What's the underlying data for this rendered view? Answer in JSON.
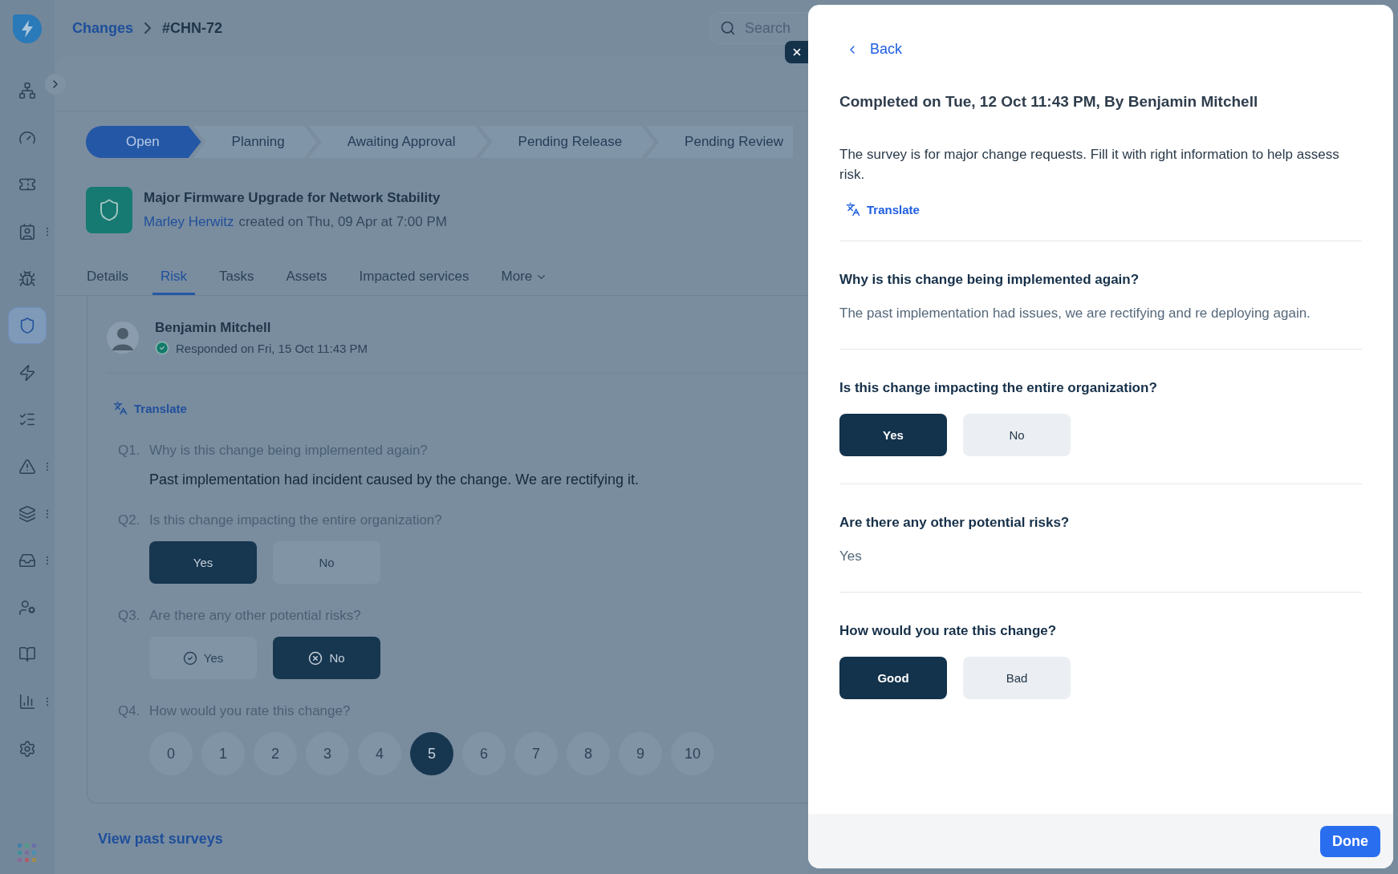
{
  "sidebar": {
    "items": [
      {
        "selected": false,
        "menu": false
      },
      {
        "selected": false,
        "menu": false
      },
      {
        "selected": false,
        "menu": false
      },
      {
        "selected": false,
        "menu": true
      },
      {
        "selected": false,
        "menu": false
      },
      {
        "selected": true,
        "menu": false
      },
      {
        "selected": false,
        "menu": false
      },
      {
        "selected": false,
        "menu": false
      },
      {
        "selected": false,
        "menu": true
      },
      {
        "selected": false,
        "menu": true
      },
      {
        "selected": false,
        "menu": true
      },
      {
        "selected": false,
        "menu": false
      },
      {
        "selected": false,
        "menu": false
      },
      {
        "selected": false,
        "menu": true
      },
      {
        "selected": false,
        "menu": false
      }
    ]
  },
  "breadcrumb": {
    "parent": "Changes",
    "current": "#CHN-72"
  },
  "search": {
    "placeholder": "Search"
  },
  "stages": [
    {
      "label": "Open",
      "selected": true
    },
    {
      "label": "Planning",
      "selected": false
    },
    {
      "label": "Awaiting Approval",
      "selected": false
    },
    {
      "label": "Pending Release",
      "selected": false
    },
    {
      "label": "Pending Review",
      "selected": false
    }
  ],
  "record": {
    "title": "Major Firmware Upgrade for Network Stability",
    "author": "Marley Herwitz",
    "created": "created on Thu, 09 Apr at 7:00 PM"
  },
  "tabs": [
    {
      "label": "Details",
      "selected": false,
      "kind": "plain"
    },
    {
      "label": "Risk",
      "selected": true,
      "kind": "plain"
    },
    {
      "label": "Tasks",
      "selected": false,
      "kind": "plain"
    },
    {
      "label": "Assets",
      "selected": false,
      "kind": "plain"
    },
    {
      "label": "Impacted services",
      "selected": false,
      "kind": "plain"
    },
    {
      "label": "More",
      "selected": false,
      "kind": "dropdown"
    }
  ],
  "response": {
    "name": "Benjamin Mitchell",
    "status": "Responded on Fri, 15 Oct 11:43 PM",
    "translate": "Translate",
    "questions": [
      {
        "number": "Q1.",
        "text": "Why is this change being implemented again?",
        "kind": "text",
        "answer": "Past implementation had incident caused by the change. We are rectifying it."
      },
      {
        "number": "Q2.",
        "text": "Is this change impacting the entire organization?",
        "kind": "choice",
        "options": [
          {
            "label": "Yes",
            "selected": true
          },
          {
            "label": "No",
            "selected": false
          }
        ]
      },
      {
        "number": "Q3.",
        "text": "Are there any other potential risks?",
        "kind": "icon-choice",
        "options": [
          {
            "label": "Yes",
            "selected": false
          },
          {
            "label": "No",
            "selected": true
          }
        ]
      },
      {
        "number": "Q4.",
        "text": "How would you rate this change?",
        "kind": "scale",
        "options": [
          {
            "label": "0",
            "selected": false
          },
          {
            "label": "1",
            "selected": false
          },
          {
            "label": "2",
            "selected": false
          },
          {
            "label": "3",
            "selected": false
          },
          {
            "label": "4",
            "selected": false
          },
          {
            "label": "5",
            "selected": true
          },
          {
            "label": "6",
            "selected": false
          },
          {
            "label": "7",
            "selected": false
          },
          {
            "label": "8",
            "selected": false
          },
          {
            "label": "9",
            "selected": false
          },
          {
            "label": "10",
            "selected": false
          }
        ]
      }
    ]
  },
  "past_surveys_link": "View past surveys",
  "panel": {
    "back": "Back",
    "heading": "Completed on Tue, 12 Oct 11:43 PM, By Benjamin Mitchell",
    "description": "The survey is for major change requests. Fill it with right information to help assess risk.",
    "translate": "Translate",
    "questions": [
      {
        "text": "Why is this change being implemented again?",
        "kind": "text",
        "answer": "The past implementation had issues, we are rectifying and re deploying again."
      },
      {
        "text": "Is this change impacting the entire organization?",
        "kind": "choice",
        "options": [
          {
            "label": "Yes",
            "selected": true
          },
          {
            "label": "No",
            "selected": false
          }
        ]
      },
      {
        "text": "Are there any other potential risks?",
        "kind": "text",
        "answer": "Yes"
      },
      {
        "text": "How would you rate this change?",
        "kind": "choice",
        "options": [
          {
            "label": "Good",
            "selected": true
          },
          {
            "label": "Bad",
            "selected": false
          }
        ]
      }
    ],
    "done": "Done"
  }
}
